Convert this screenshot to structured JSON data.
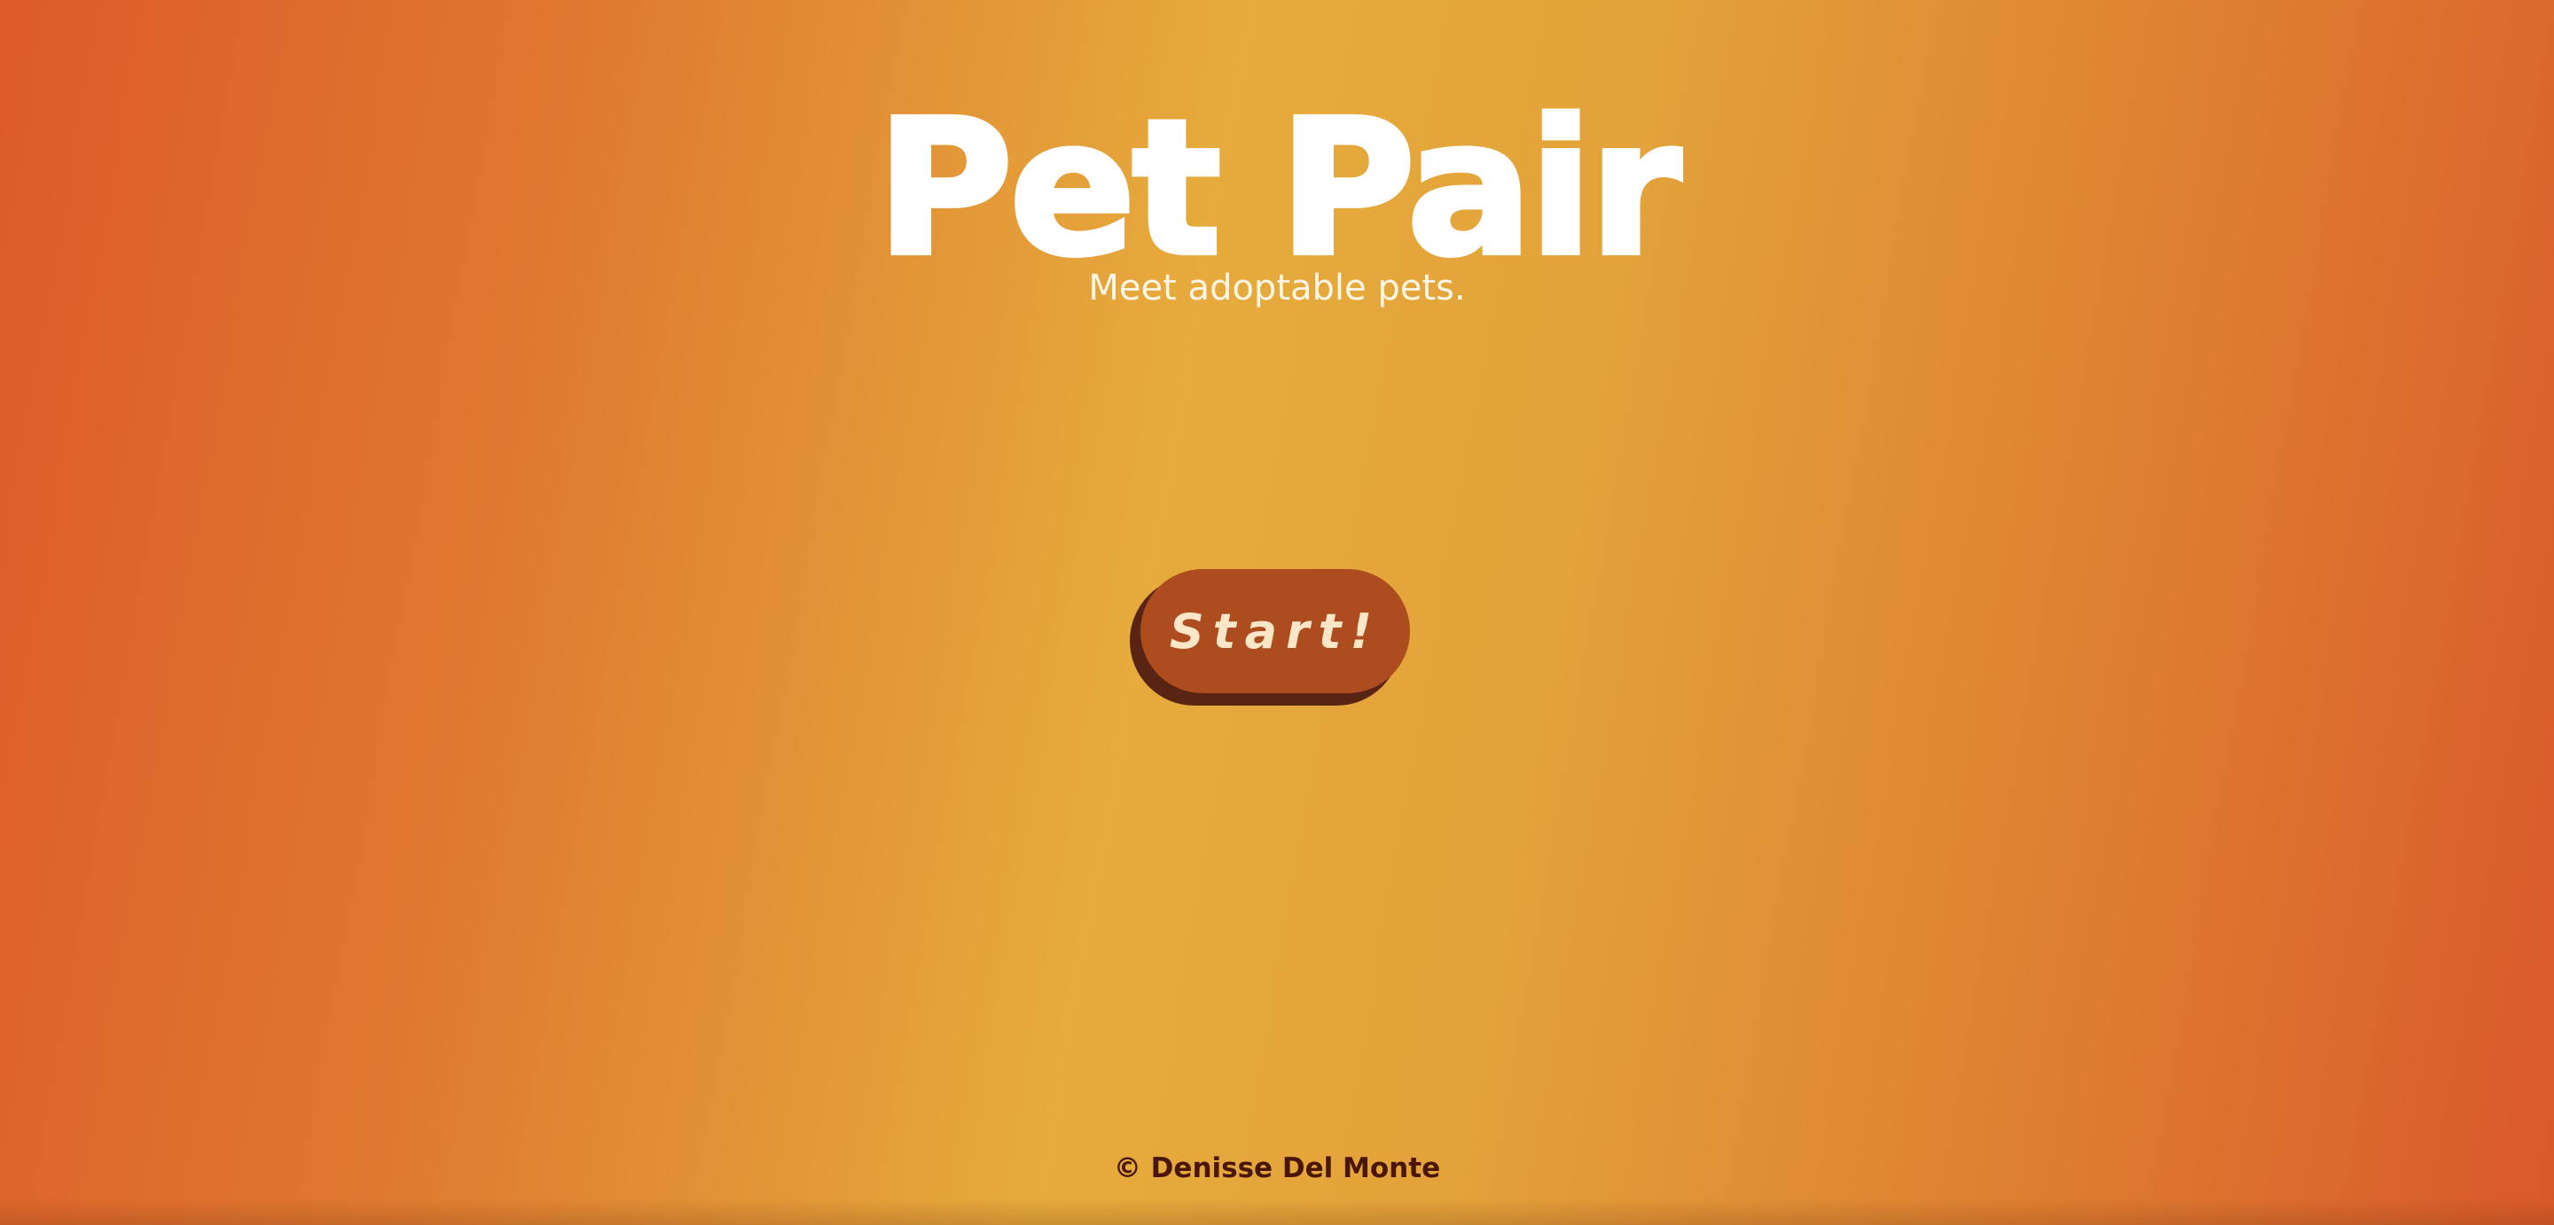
{
  "header": {
    "title": "Pet Pair",
    "subtitle": "Meet adoptable pets."
  },
  "main": {
    "start_label": "Start!"
  },
  "footer": {
    "copyright": "© Denisse Del Monte"
  },
  "colors": {
    "background_center": "#e6ab3c",
    "background_edge": "#de5a28",
    "button": "#ad4c1e",
    "button_shadow": "#5a2414",
    "button_text": "#fbe7c8",
    "footer_text": "#4a1608"
  }
}
